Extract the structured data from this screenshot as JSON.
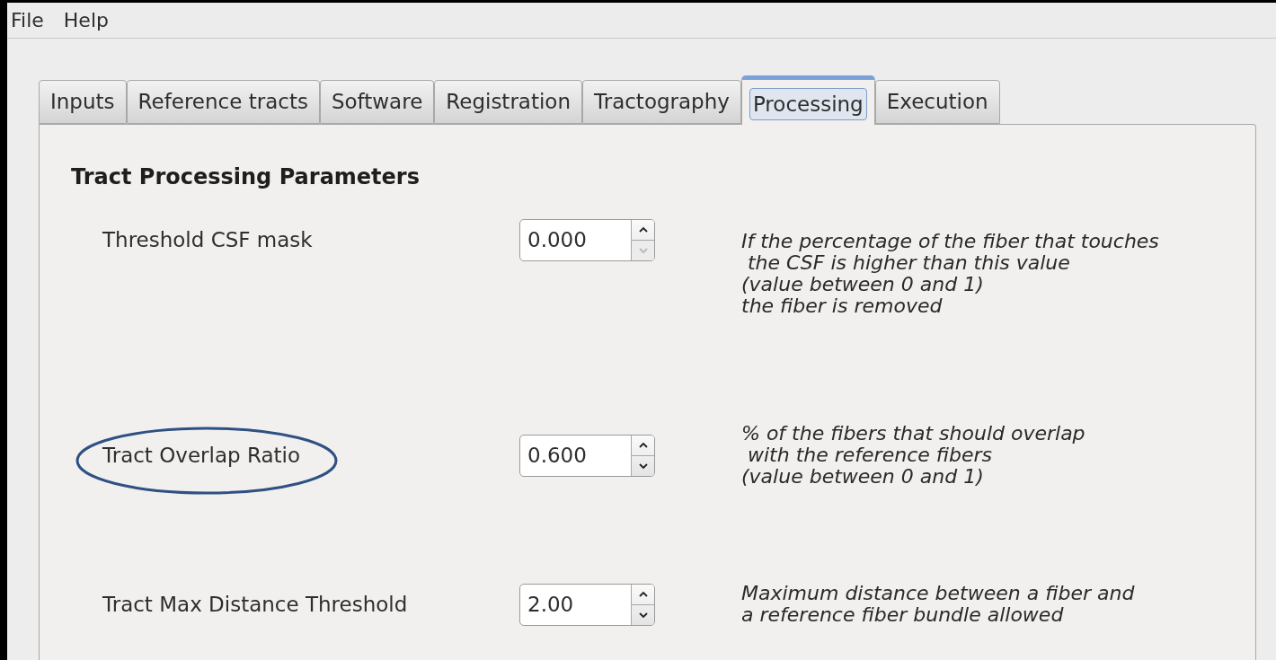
{
  "menu": [
    "File",
    "Help"
  ],
  "tabs": [
    {
      "label": "Inputs",
      "selected": false
    },
    {
      "label": "Reference tracts",
      "selected": false
    },
    {
      "label": "Software",
      "selected": false
    },
    {
      "label": "Registration",
      "selected": false
    },
    {
      "label": "Tractography",
      "selected": false
    },
    {
      "label": "Processing",
      "selected": true
    },
    {
      "label": "Execution",
      "selected": false
    }
  ],
  "section_title": "Tract Processing Parameters",
  "parameters": [
    {
      "label": "Threshold CSF mask",
      "value": "0.000",
      "down_disabled": true,
      "highlighted": false,
      "description": "If the percentage of the fiber that touches\n the CSF is higher than this value\n(value between 0 and 1)\nthe fiber is removed"
    },
    {
      "label": "Tract Overlap Ratio",
      "value": "0.600",
      "down_disabled": false,
      "highlighted": true,
      "description": "% of the fibers that should overlap\n with the reference fibers\n(value between 0 and 1)"
    },
    {
      "label": "Tract Max Distance Threshold",
      "value": "2.00",
      "down_disabled": false,
      "highlighted": false,
      "description": "Maximum distance between a fiber and\na reference fiber bundle allowed"
    }
  ]
}
